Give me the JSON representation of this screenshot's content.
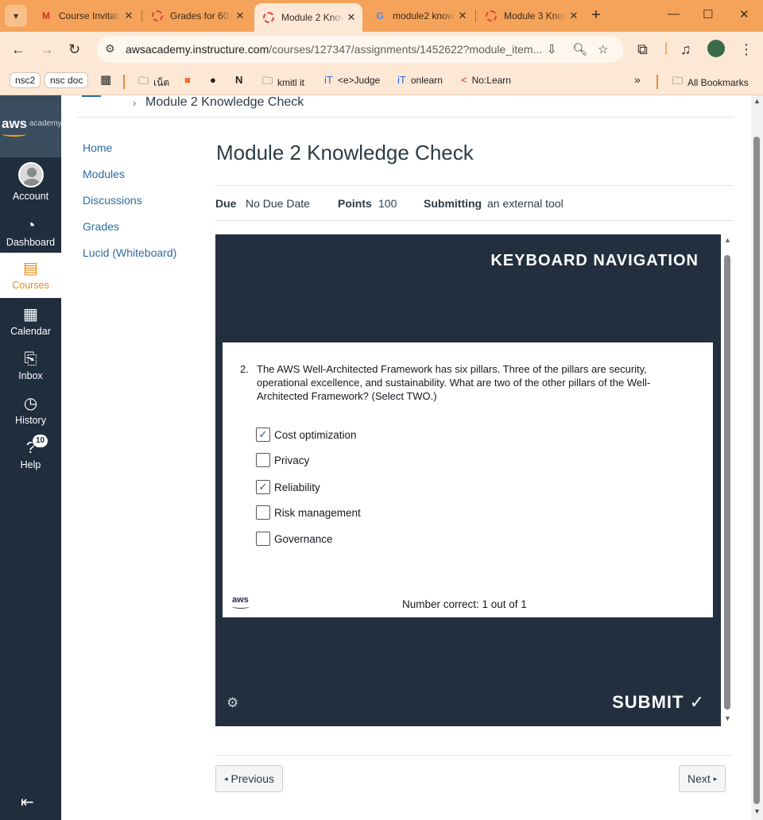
{
  "browser": {
    "tabs": [
      {
        "title": "Course Invitation",
        "icon": "gmail-icon"
      },
      {
        "title": "Grades for 6013",
        "icon": "canvas-icon"
      },
      {
        "title": "Module 2 Knowledge Check",
        "icon": "canvas-icon",
        "active": true
      },
      {
        "title": "module2 knowledge check",
        "icon": "google-icon"
      },
      {
        "title": "Module 3 Knowledge Check",
        "icon": "canvas-icon"
      }
    ],
    "url_host": "awsacademy.instructure.com",
    "url_path": "/courses/127347/assignments/1452622?module_item...",
    "bookmarks": {
      "b1": "nsc2",
      "b2": "nsc doc",
      "b3": "เน็ต",
      "b4": "kmitl it",
      "b5": "<e>Judge",
      "b6": "onlearn",
      "b7": "No:Learn",
      "all": "All Bookmarks"
    }
  },
  "global_nav": {
    "logo_text": "aws",
    "logo_sub": "academy",
    "items": {
      "account": "Account",
      "dashboard": "Dashboard",
      "courses": "Courses",
      "calendar": "Calendar",
      "inbox": "Inbox",
      "history": "History",
      "help": "Help"
    },
    "help_badge": "10"
  },
  "breadcrumb": "Module 2 Knowledge Check",
  "course_nav": {
    "home": "Home",
    "modules": "Modules",
    "discussions": "Discussions",
    "grades": "Grades",
    "lucid": "Lucid (Whiteboard)"
  },
  "assignment": {
    "title": "Module 2 Knowledge Check",
    "due_label": "Due",
    "due_value": "No Due Date",
    "points_label": "Points",
    "points_value": "100",
    "submitting_label": "Submitting",
    "submitting_value": "an external tool"
  },
  "tool": {
    "keyboard_nav": "KEYBOARD NAVIGATION",
    "question_number": "2.",
    "question_text": "The AWS Well-Architected Framework has six pillars. Three of the pillars are security, operational excellence, and sustainability. What are two of the other pillars of the Well-Architected Framework? (Select TWO.)",
    "options": [
      {
        "label": "Cost optimization",
        "checked": true
      },
      {
        "label": "Privacy",
        "checked": false
      },
      {
        "label": "Reliability",
        "checked": true
      },
      {
        "label": "Risk management",
        "checked": false
      },
      {
        "label": "Governance",
        "checked": false
      }
    ],
    "aws_mark": "aws",
    "number_correct": "Number correct: 1 out of 1",
    "submit": "SUBMIT"
  },
  "footer": {
    "previous": "Previous",
    "next": "Next"
  }
}
